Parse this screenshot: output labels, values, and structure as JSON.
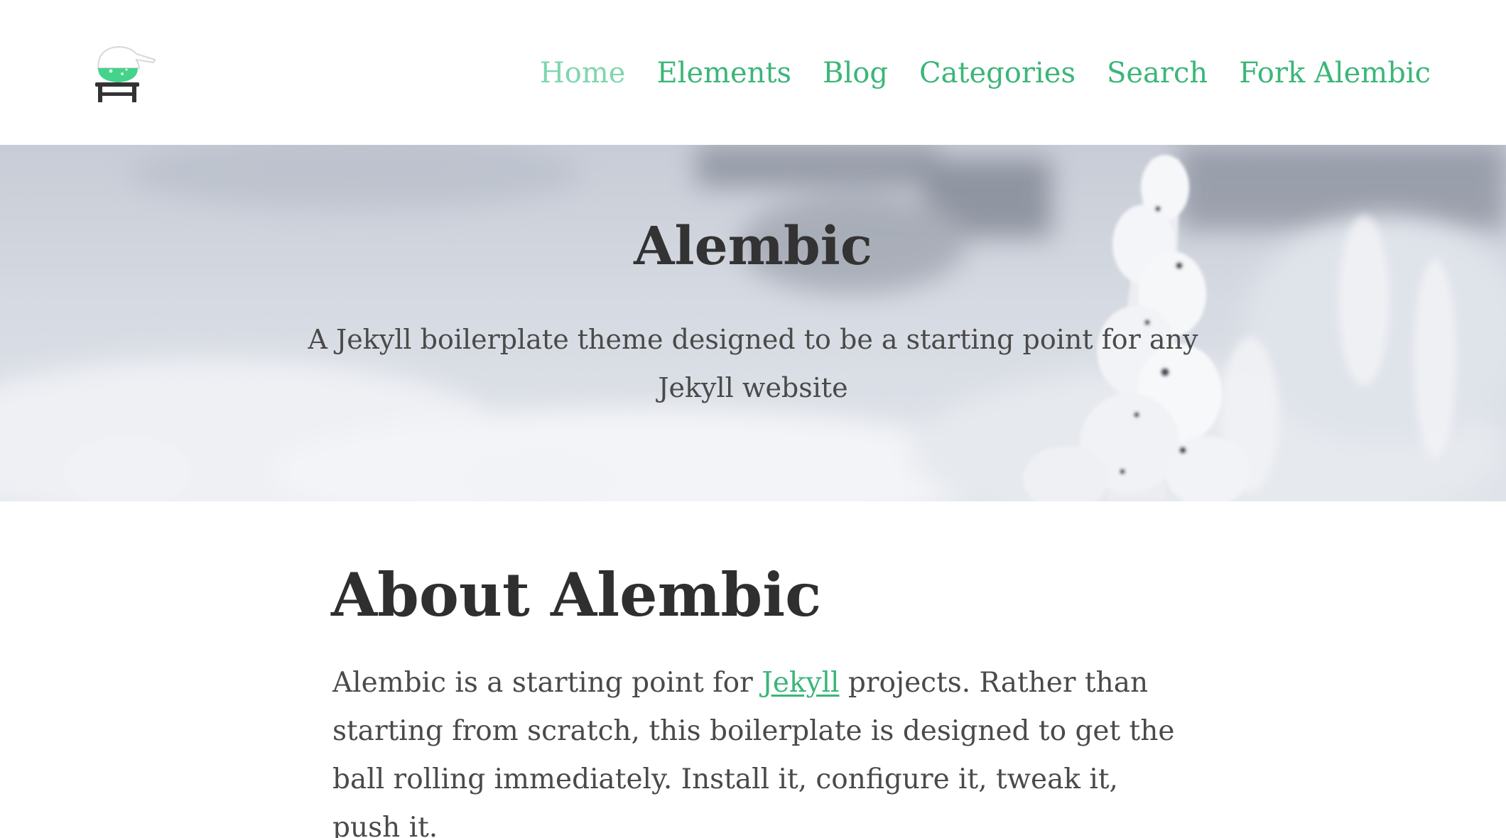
{
  "nav": {
    "items": [
      {
        "label": "Home",
        "active": true
      },
      {
        "label": "Elements",
        "active": false
      },
      {
        "label": "Blog",
        "active": false
      },
      {
        "label": "Categories",
        "active": false
      },
      {
        "label": "Search",
        "active": false
      },
      {
        "label": "Fork Alembic",
        "active": false
      }
    ]
  },
  "hero": {
    "title": "Alembic",
    "tagline": "A Jekyll boilerplate theme designed to be a starting point for any Jekyll website"
  },
  "about": {
    "title": "About Alembic",
    "text_before": "Alembic is a starting point for ",
    "link_text": "Jekyll",
    "text_after": " projects. Rather than starting from scratch, this boilerplate is designed to get the ball rolling immediately. Install it, configure it, tweak it, push it."
  },
  "colors": {
    "accent": "#3bb679",
    "accent_active": "#7fd6ae",
    "text": "#333333"
  },
  "icons": {
    "logo": "alembic-flask-logo-icon"
  }
}
